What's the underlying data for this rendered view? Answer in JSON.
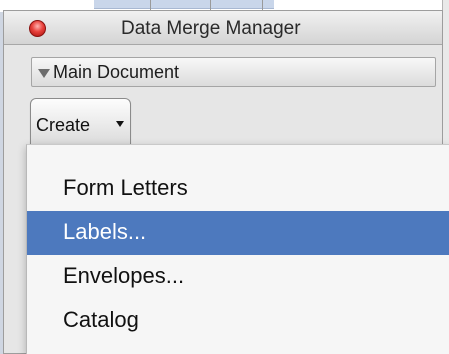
{
  "window": {
    "title": "Data Merge Manager"
  },
  "section": {
    "label": "Main Document",
    "expanded": true
  },
  "create_button": {
    "label": "Create"
  },
  "menu": {
    "items": [
      {
        "label": "Form Letters",
        "selected": false
      },
      {
        "label": "Labels...",
        "selected": true
      },
      {
        "label": "Envelopes...",
        "selected": false
      },
      {
        "label": "Catalog",
        "selected": false
      }
    ]
  },
  "colors": {
    "selection": "#4d79be",
    "close_button": "#e8413c"
  },
  "icons": {
    "close": "close-button-icon",
    "disclosure": "disclosure-triangle-down-icon",
    "popup_arrow": "popup-arrow-down-icon"
  }
}
